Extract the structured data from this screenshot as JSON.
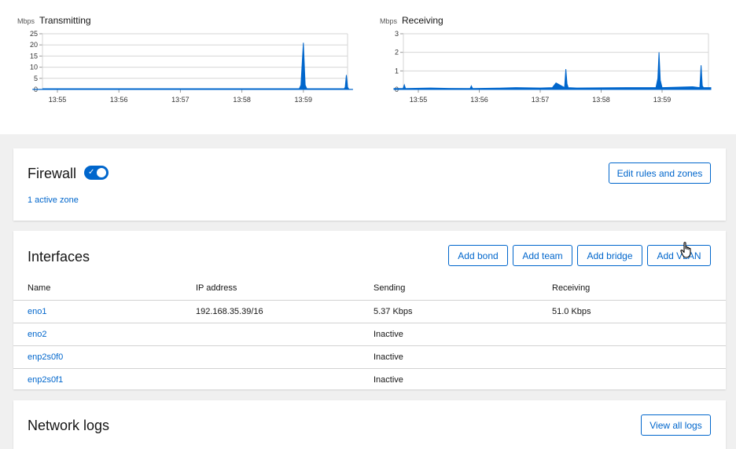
{
  "charts": [
    {
      "unit": "Mbps",
      "title": "Transmitting",
      "y_ticks": [
        "25",
        "20",
        "15",
        "10",
        "5",
        "0"
      ],
      "x_ticks": [
        "13:55",
        "13:56",
        "13:57",
        "13:58",
        "13:59"
      ],
      "color": "#0066cc"
    },
    {
      "unit": "Mbps",
      "title": "Receiving",
      "y_ticks": [
        "3",
        "2",
        "1",
        "0"
      ],
      "x_ticks": [
        "13:55",
        "13:56",
        "13:57",
        "13:58",
        "13:59"
      ],
      "color": "#0066cc"
    }
  ],
  "chart_data": [
    {
      "type": "area",
      "title": "Transmitting",
      "ylabel": "Mbps",
      "ylim": [
        0,
        25
      ],
      "x_ticks": [
        "13:55",
        "13:56",
        "13:57",
        "13:58",
        "13:59"
      ],
      "series": [
        {
          "x_minutes": [
            54.6,
            58.93,
            58.96,
            59.0,
            59.03,
            59.06,
            59.66,
            59.68,
            59.7,
            59.72,
            59.74,
            59.8
          ],
          "values": [
            0.1,
            0.1,
            2,
            21,
            2,
            0.1,
            0.1,
            1,
            6.5,
            1,
            0.1,
            0.1
          ]
        }
      ]
    },
    {
      "type": "area",
      "title": "Receiving",
      "ylabel": "Mbps",
      "ylim": [
        0,
        3
      ],
      "x_ticks": [
        "13:55",
        "13:56",
        "13:57",
        "13:58",
        "13:59"
      ],
      "series": [
        {
          "x_minutes": [
            54.6,
            54.75,
            54.77,
            54.79,
            55.2,
            55.5,
            55.85,
            55.87,
            55.89,
            56.3,
            56.6,
            57.0,
            57.2,
            57.26,
            57.4,
            57.42,
            57.44,
            57.46,
            57.6,
            58.4,
            58.9,
            58.93,
            58.95,
            58.97,
            59.0,
            59.5,
            59.62,
            59.64,
            59.66,
            59.68,
            59.8
          ],
          "values": [
            0.05,
            0.05,
            0.25,
            0.05,
            0.08,
            0.06,
            0.05,
            0.2,
            0.05,
            0.07,
            0.1,
            0.08,
            0.1,
            0.35,
            0.1,
            1.1,
            0.3,
            0.1,
            0.08,
            0.1,
            0.1,
            0.6,
            2.0,
            0.5,
            0.1,
            0.15,
            0.1,
            1.3,
            0.2,
            0.1,
            0.1
          ]
        }
      ]
    }
  ],
  "firewall": {
    "title": "Firewall",
    "enabled": true,
    "active_zone_link": "1 active zone",
    "edit_button": "Edit rules and zones"
  },
  "interfaces": {
    "title": "Interfaces",
    "buttons": [
      "Add bond",
      "Add team",
      "Add bridge",
      "Add VLAN"
    ],
    "columns": [
      "Name",
      "IP address",
      "Sending",
      "Receiving"
    ],
    "rows": [
      {
        "name": "eno1",
        "ip": "192.168.35.39/16",
        "sending": "5.37 Kbps",
        "receiving": "51.0 Kbps"
      },
      {
        "name": "eno2",
        "ip": "",
        "sending": "Inactive",
        "receiving": ""
      },
      {
        "name": "enp2s0f0",
        "ip": "",
        "sending": "Inactive",
        "receiving": ""
      },
      {
        "name": "enp2s0f1",
        "ip": "",
        "sending": "Inactive",
        "receiving": ""
      }
    ]
  },
  "network_logs": {
    "title": "Network logs",
    "view_button": "View all logs"
  }
}
